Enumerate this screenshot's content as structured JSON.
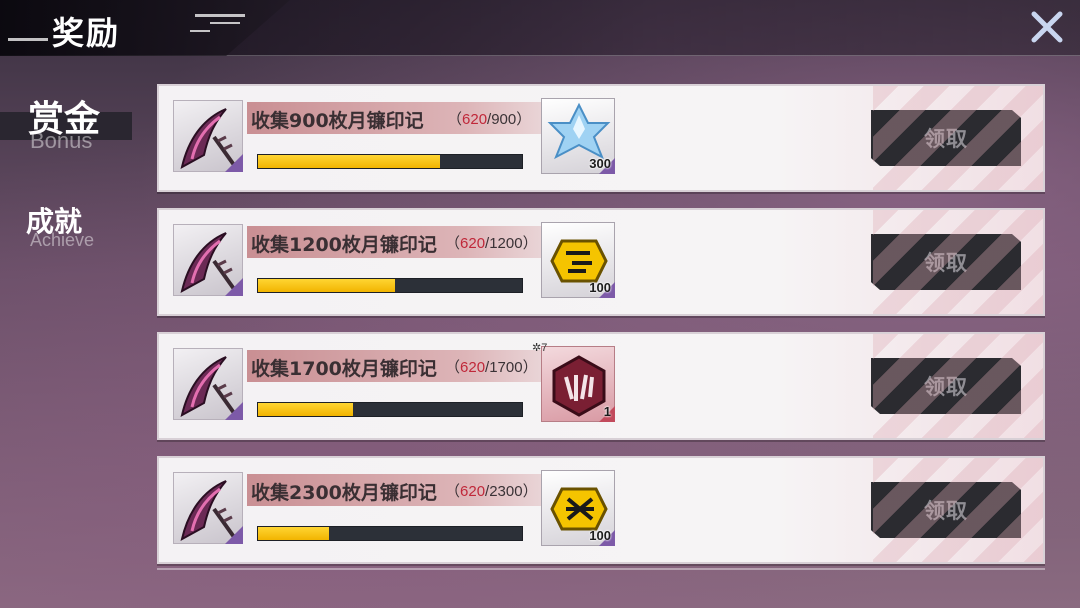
{
  "header": {
    "title": "奖励",
    "close_icon": "close-x-icon"
  },
  "tabs": [
    {
      "label": "赏金",
      "sub": "Bonus",
      "active": true
    },
    {
      "label": "成就",
      "sub": "Achieve",
      "active": false
    }
  ],
  "rows": [
    {
      "task": "收集900枚月镰印记",
      "current": "620",
      "total": "/900",
      "progress": 0.69,
      "reward_count": "300",
      "reward_icon": "star-crystal-icon",
      "claim": "领取"
    },
    {
      "task": "收集1200枚月镰印记",
      "current": "620",
      "total": "/1200",
      "progress": 0.52,
      "reward_count": "100",
      "reward_icon": "gold-chip-icon",
      "claim": "领取"
    },
    {
      "task": "收集1700枚月镰印记",
      "current": "620",
      "total": "/1700",
      "progress": 0.36,
      "reward_count": "1",
      "reward_tag": "7",
      "reward_icon": "red-emblem-icon",
      "claim": "领取"
    },
    {
      "task": "收集2300枚月镰印记",
      "current": "620",
      "total": "/2300",
      "progress": 0.27,
      "reward_count": "100",
      "reward_icon": "gold-chip-icon",
      "claim": "领取"
    }
  ],
  "colors": {
    "progress_fill": "#f2b400",
    "current_value": "#c0283a",
    "button_bg": "#2b2b30"
  }
}
